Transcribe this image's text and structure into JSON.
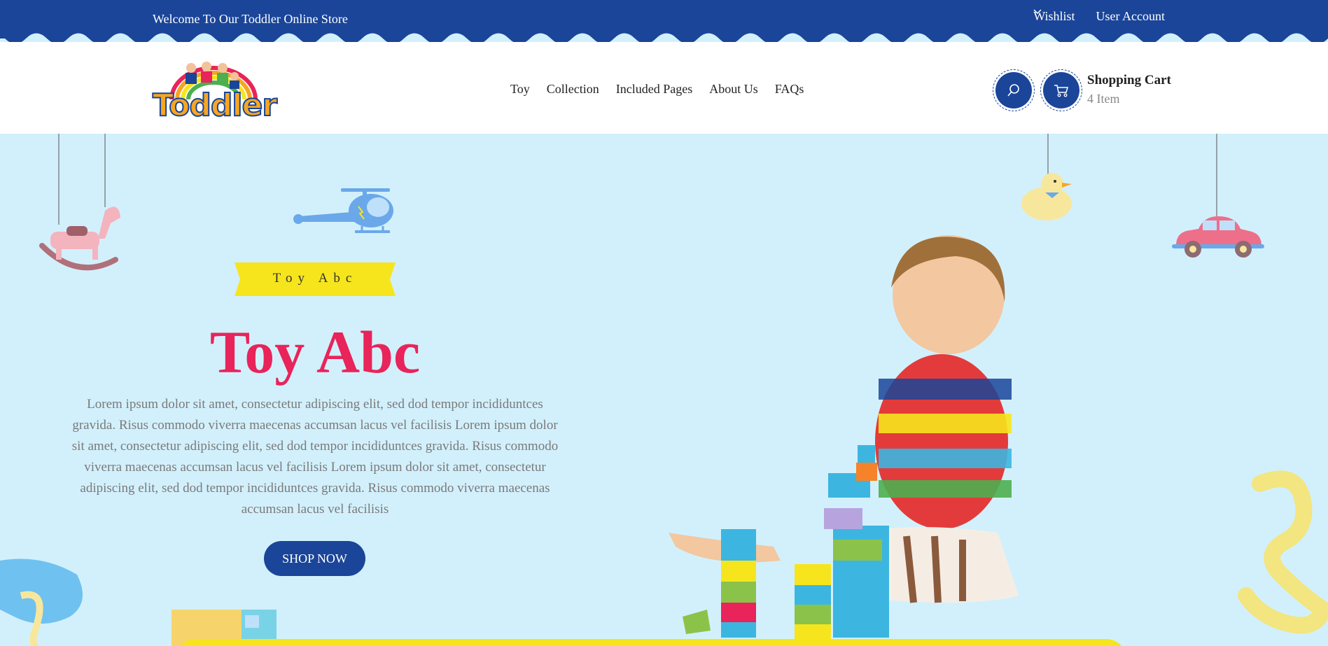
{
  "topbar": {
    "welcome": "Welcome To Our Toddler Online Store",
    "wishlist": "Wishlist",
    "account": "User Account"
  },
  "header": {
    "logo_text": "Toddler",
    "nav": [
      "Toy",
      "Collection",
      "Included Pages",
      "About Us",
      "FAQs"
    ],
    "cart_title": "Shopping Cart",
    "cart_count": "4 Item"
  },
  "hero": {
    "ribbon": "Toy Abc",
    "title": "Toy Abc",
    "description": "Lorem ipsum dolor sit amet, consectetur adipiscing elit, sed dod tempor incididuntces gravida. Risus commodo viverra maecenas accumsan lacus vel facilisis Lorem ipsum dolor sit amet, consectetur adipiscing elit, sed dod tempor incididuntces gravida. Risus commodo viverra maecenas accumsan lacus vel facilisis Lorem ipsum dolor sit amet, consectetur adipiscing elit, sed dod tempor incididuntces gravida. Risus commodo viverra maecenas accumsan lacus vel facilisis",
    "button": "SHOP NOW"
  },
  "colors": {
    "primary": "#1a4599",
    "accent": "#e8245a",
    "hero_bg": "#d2f0fc",
    "ribbon": "#f6e51d"
  },
  "icons": [
    "chevron-down-icon",
    "search-icon",
    "cart-icon"
  ]
}
